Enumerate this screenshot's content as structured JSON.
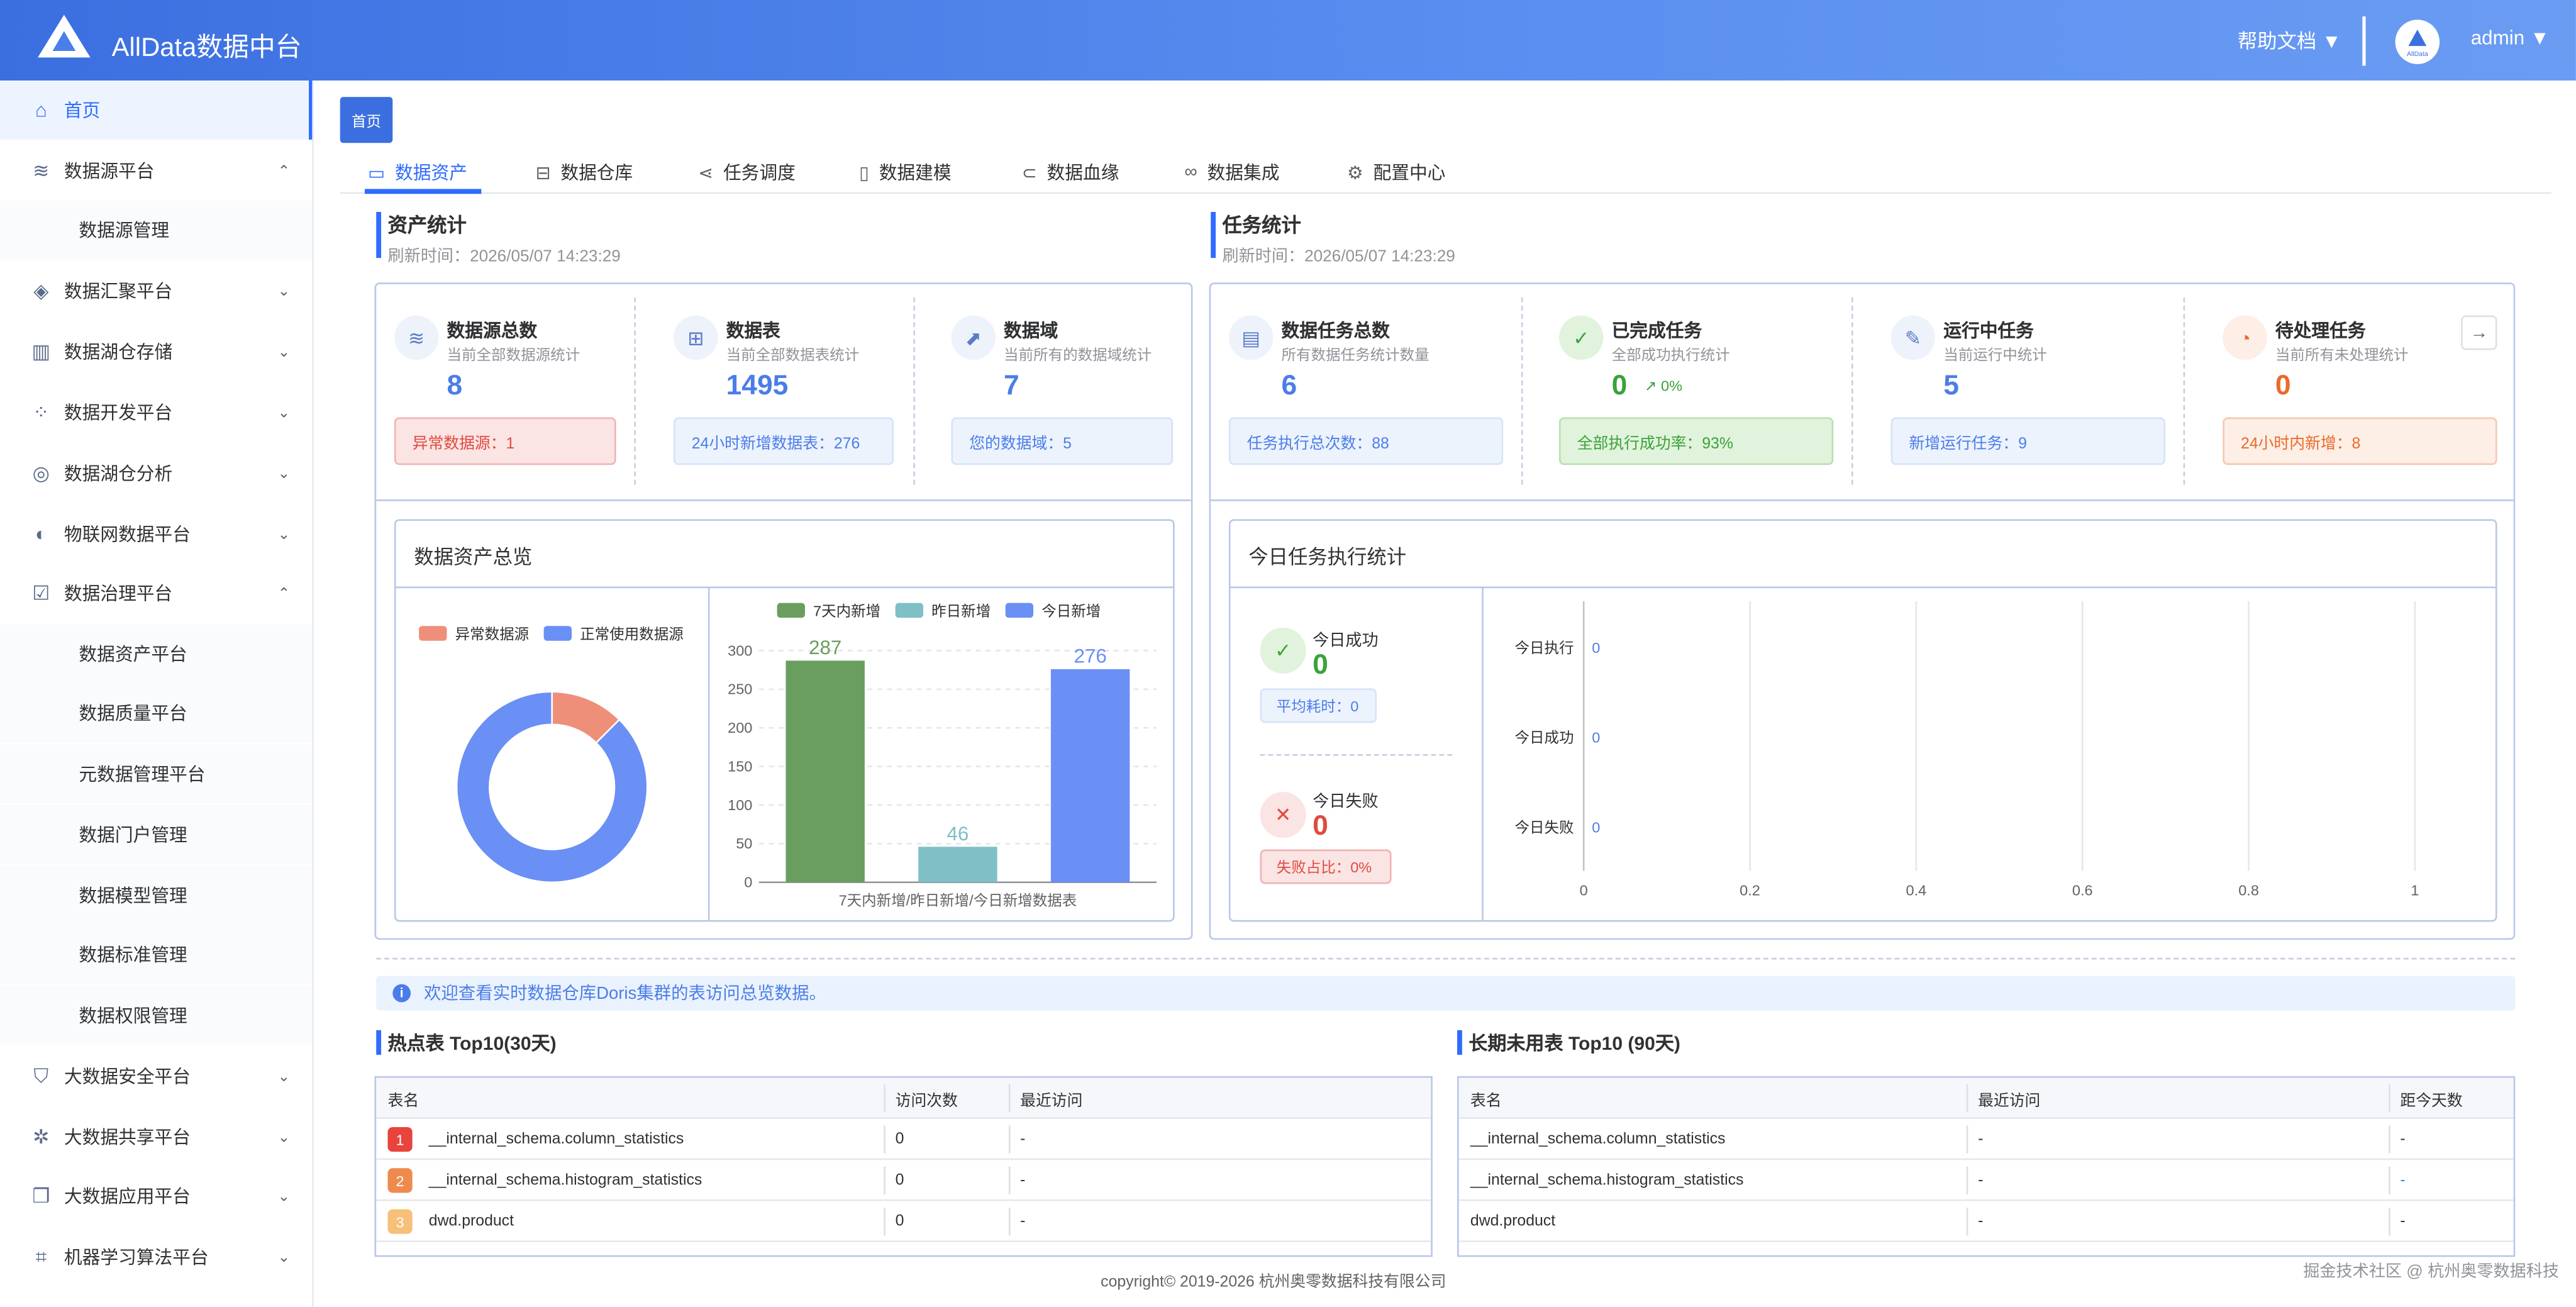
{
  "header": {
    "app_title": "AllData数据中台",
    "help_label": "帮助文档 ▼",
    "user_label": "admin ▼",
    "avatar_text": "AllData"
  },
  "sidebar": {
    "items": [
      {
        "label": "首页",
        "icon": "home-icon"
      },
      {
        "label": "数据源平台",
        "icon": "database-icon"
      },
      {
        "label": "数据源管理"
      },
      {
        "label": "数据汇聚平台",
        "icon": "layers-icon"
      },
      {
        "label": "数据湖仓存储",
        "icon": "storage-icon"
      },
      {
        "label": "数据开发平台",
        "icon": "grid-icon"
      },
      {
        "label": "数据湖仓分析",
        "icon": "analysis-icon"
      },
      {
        "label": "物联网数据平台",
        "icon": "iot-icon"
      },
      {
        "label": "数据治理平台",
        "icon": "governance-icon"
      },
      {
        "label": "数据资产平台"
      },
      {
        "label": "数据质量平台"
      },
      {
        "label": "元数据管理平台"
      },
      {
        "label": "数据门户管理"
      },
      {
        "label": "数据模型管理"
      },
      {
        "label": "数据标准管理"
      },
      {
        "label": "数据权限管理"
      },
      {
        "label": "大数据安全平台",
        "icon": "security-icon"
      },
      {
        "label": "大数据共享平台",
        "icon": "share-icon"
      },
      {
        "label": "大数据应用平台",
        "icon": "app-icon"
      },
      {
        "label": "机器学习算法平台",
        "icon": "ml-icon"
      }
    ]
  },
  "breadcrumb_tag": "首页",
  "tabs": [
    {
      "label": "数据资产",
      "icon": "monitor-icon"
    },
    {
      "label": "数据仓库",
      "icon": "warehouse-icon"
    },
    {
      "label": "任务调度",
      "icon": "share-nodes-icon"
    },
    {
      "label": "数据建模",
      "icon": "book-icon"
    },
    {
      "label": "数据血缘",
      "icon": "lineage-icon"
    },
    {
      "label": "数据集成",
      "icon": "link-icon"
    },
    {
      "label": "配置中心",
      "icon": "gear-icon"
    }
  ],
  "asset_stats": {
    "title": "资产统计",
    "refresh": "刷新时间：2026/05/07 14:23:29",
    "cards": [
      {
        "title": "数据源总数",
        "sub": "当前全部数据源统计",
        "value": "8",
        "pill": "异常数据源：1"
      },
      {
        "title": "数据表",
        "sub": "当前全部数据表统计",
        "value": "1495",
        "pill": "24小时新增数据表：276"
      },
      {
        "title": "数据域",
        "sub": "当前所有的数据域统计",
        "value": "7",
        "pill": "您的数据域：5"
      }
    ]
  },
  "task_stats": {
    "title": "任务统计",
    "refresh": "刷新时间：2026/05/07 14:23:29",
    "cards": [
      {
        "title": "数据任务总数",
        "sub": "所有数据任务统计数量",
        "value": "6",
        "pill": "任务执行总次数：88"
      },
      {
        "title": "已完成任务",
        "sub": "全部成功执行统计",
        "value": "0",
        "trend": "0%",
        "pill": "全部执行成功率：93%"
      },
      {
        "title": "运行中任务",
        "sub": "当前运行中统计",
        "value": "5",
        "pill": "新增运行任务：9"
      },
      {
        "title": "待处理任务",
        "sub": "当前所有未处理统计",
        "value": "0",
        "pill": "24小时内新增：8"
      }
    ]
  },
  "overview": {
    "title": "数据资产总览",
    "donut_legend": [
      "异常数据源",
      "正常使用数据源"
    ]
  },
  "today": {
    "title": "今日任务执行统计",
    "success_label": "今日成功",
    "success_value": "0",
    "avg_label": "平均耗时：0",
    "fail_label": "今日失败",
    "fail_value": "0",
    "fail_ratio": "失败占比：0%"
  },
  "colors": {
    "accent": "#2f6bff",
    "bar_7d": "#6a9e5e",
    "bar_yesterday": "#7fbfc6",
    "bar_today": "#6a8ff5",
    "donut_abnormal": "#ee8f7a",
    "donut_normal": "#6a8ff5"
  },
  "chart_data": [
    {
      "type": "pie",
      "legend": [
        "异常数据源",
        "正常使用数据源"
      ],
      "values": [
        1,
        7
      ],
      "series_colors": [
        "#ee8f7a",
        "#6a8ff5"
      ]
    },
    {
      "type": "bar",
      "categories": [
        "7天内新增",
        "昨日新增",
        "今日新增"
      ],
      "values": [
        287,
        46,
        276
      ],
      "xlabel": "7天内新增/昨日新增/今日新增数据表",
      "ylim": [
        0,
        300
      ],
      "yticks": [
        0,
        50,
        100,
        150,
        200,
        250,
        300
      ],
      "legend": [
        "7天内新增",
        "昨日新增",
        "今日新增"
      ]
    },
    {
      "type": "bar",
      "orientation": "horizontal",
      "categories": [
        "今日执行",
        "今日成功",
        "今日失败"
      ],
      "values": [
        0,
        0,
        0
      ],
      "xlim": [
        0,
        1
      ],
      "xticks": [
        "0",
        "0.2",
        "0.4",
        "0.6",
        "0.8",
        "1"
      ]
    }
  ],
  "info_text": "欢迎查看实时数据仓库Doris集群的表访问总览数据。",
  "hot_table": {
    "title": "热点表 Top10(30天)",
    "headers": [
      "表名",
      "访问次数",
      "最近访问"
    ],
    "rows": [
      {
        "rank": "1",
        "name": "__internal_schema.column_statistics",
        "count": "0",
        "last": "-"
      },
      {
        "rank": "2",
        "name": "__internal_schema.histogram_statistics",
        "count": "0",
        "last": "-"
      },
      {
        "rank": "3",
        "name": "dwd.product",
        "count": "0",
        "last": "-"
      }
    ]
  },
  "idle_table": {
    "title": "长期未用表 Top10 (90天)",
    "headers": [
      "表名",
      "最近访问",
      "距今天数"
    ],
    "rows": [
      {
        "name": "__internal_schema.column_statistics",
        "last": "-",
        "days": "-"
      },
      {
        "name": "__internal_schema.histogram_statistics",
        "last": "-",
        "days": "-"
      },
      {
        "name": "dwd.product",
        "last": "-",
        "days": "-"
      }
    ]
  },
  "footer": "copyright© 2019-2026 杭州奥零数据科技有限公司",
  "watermark": "掘金技术社区 @ 杭州奥零数据科技"
}
